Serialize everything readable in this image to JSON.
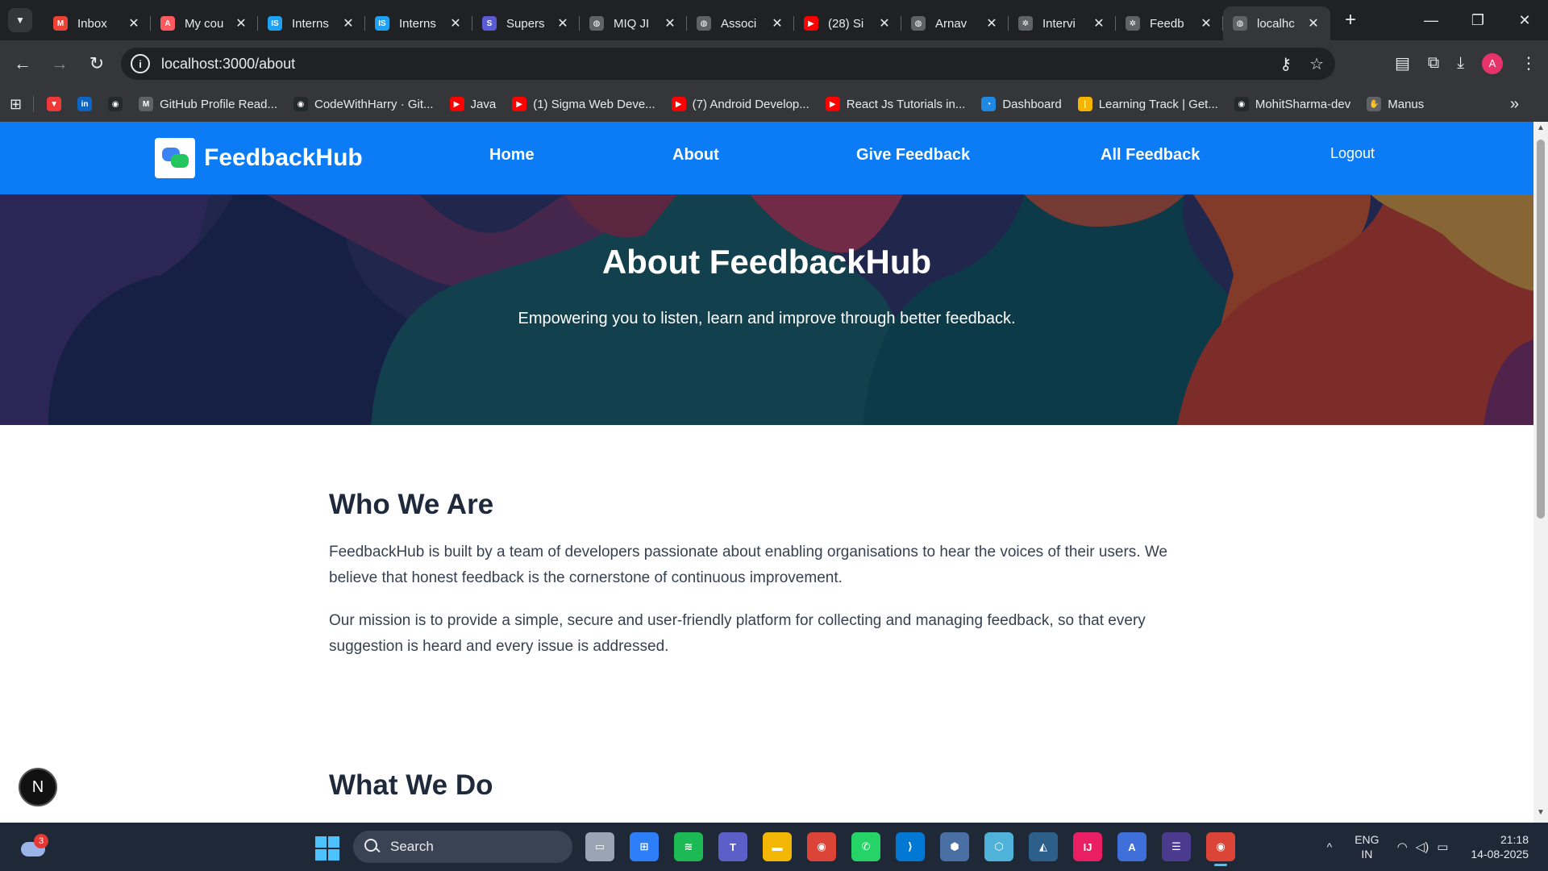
{
  "browser": {
    "tabs": [
      {
        "title": "Inbox",
        "favicon": "gmail-icon",
        "color": "#ea4335",
        "glyph": "M"
      },
      {
        "title": "My cou",
        "favicon": "airbnb-icon",
        "color": "#ff5a5f",
        "glyph": "A"
      },
      {
        "title": "Interns",
        "favicon": "internshala-icon",
        "color": "#1da1f2",
        "glyph": "IS"
      },
      {
        "title": "Interns",
        "favicon": "internshala-icon",
        "color": "#1da1f2",
        "glyph": "IS"
      },
      {
        "title": "Supers",
        "favicon": "superset-icon",
        "color": "#5b5bd6",
        "glyph": "S"
      },
      {
        "title": "MIQ JI",
        "favicon": "globe-icon",
        "color": "#5f6368",
        "glyph": "◍"
      },
      {
        "title": "Associ",
        "favicon": "globe-icon",
        "color": "#5f6368",
        "glyph": "◍"
      },
      {
        "title": "(28) Si",
        "favicon": "youtube-icon",
        "color": "#ff0000",
        "glyph": "▶"
      },
      {
        "title": "Arnav",
        "favicon": "globe-icon",
        "color": "#5f6368",
        "glyph": "◍"
      },
      {
        "title": "Intervi",
        "favicon": "chatgpt-icon",
        "color": "#5f6368",
        "glyph": "✲"
      },
      {
        "title": "Feedb",
        "favicon": "chatgpt-icon",
        "color": "#5f6368",
        "glyph": "✲"
      },
      {
        "title": "localhc",
        "favicon": "globe-icon",
        "color": "#5f6368",
        "glyph": "◍",
        "active": true
      }
    ],
    "url": "localhost:3000/about",
    "profile_initial": "A",
    "bookmarks": [
      {
        "label": "",
        "icon": "vivaldi-icon",
        "color": "#ef3939",
        "glyph": "▼"
      },
      {
        "label": "",
        "icon": "linkedin-icon",
        "color": "#0a66c2",
        "glyph": "in"
      },
      {
        "label": "",
        "icon": "github-icon",
        "color": "#24292e",
        "glyph": "◉"
      },
      {
        "label": "GitHub Profile Read...",
        "icon": "markdown-icon",
        "color": "#5f6368",
        "glyph": "M"
      },
      {
        "label": "CodeWithHarry · Git...",
        "icon": "github-icon",
        "color": "#24292e",
        "glyph": "◉"
      },
      {
        "label": "Java",
        "icon": "youtube-icon",
        "color": "#ff0000",
        "glyph": "▶"
      },
      {
        "label": "(1) Sigma Web Deve...",
        "icon": "youtube-icon",
        "color": "#ff0000",
        "glyph": "▶"
      },
      {
        "label": "(7) Android Develop...",
        "icon": "youtube-icon",
        "color": "#ff0000",
        "glyph": "▶"
      },
      {
        "label": "React Js Tutorials in...",
        "icon": "youtube-icon",
        "color": "#ff0000",
        "glyph": "▶"
      },
      {
        "label": "Dashboard",
        "icon": "dashboard-icon",
        "color": "#1e88e5",
        "glyph": "◔"
      },
      {
        "label": "Learning Track | Get...",
        "icon": "learning-track-icon",
        "color": "#f4b400",
        "glyph": "|"
      },
      {
        "label": "MohitSharma-dev",
        "icon": "github-icon",
        "color": "#24292e",
        "glyph": "◉"
      },
      {
        "label": "Manus",
        "icon": "manus-icon",
        "color": "#5f6368",
        "glyph": "✋"
      }
    ]
  },
  "app": {
    "brand": "FeedbackHub",
    "nav": [
      {
        "label": "Home",
        "key": "home"
      },
      {
        "label": "About",
        "key": "about"
      },
      {
        "label": "Give Feedback",
        "key": "give-feedback"
      },
      {
        "label": "All Feedback",
        "key": "all-feedback"
      }
    ],
    "logout_label": "Logout",
    "accent_color": "#0b7cf5"
  },
  "hero": {
    "title": "About FeedbackHub",
    "subtitle": "Empowering you to listen, learn and improve through better feedback."
  },
  "sections": {
    "who": {
      "heading": "Who We Are",
      "p1": "FeedbackHub is built by a team of developers passionate about enabling organisations to hear the voices of their users. We believe that honest feedback is the cornerstone of continuous improvement.",
      "p2": "Our mission is to provide a simple, secure and user-friendly platform for collecting and managing feedback, so that every suggestion is heard and every issue is addressed."
    },
    "what": {
      "heading": "What We Do"
    }
  },
  "overlay": {
    "badge_letter": "N"
  },
  "taskbar": {
    "weather_badge": "3",
    "search_label": "Search",
    "apps": [
      {
        "icon": "task-view-icon",
        "color": "#9aa4b5",
        "glyph": "▭"
      },
      {
        "icon": "microsoft-store-icon",
        "color": "#2d7ff9",
        "glyph": "⊞"
      },
      {
        "icon": "spotify-icon",
        "color": "#1db954",
        "glyph": "≋"
      },
      {
        "icon": "teams-icon",
        "color": "#5b5fc7",
        "glyph": "T"
      },
      {
        "icon": "file-explorer-icon",
        "color": "#f2b705",
        "glyph": "▬"
      },
      {
        "icon": "chrome-icon",
        "color": "#db4437",
        "glyph": "◉"
      },
      {
        "icon": "whatsapp-icon",
        "color": "#25d366",
        "glyph": "✆"
      },
      {
        "icon": "vscode-icon",
        "color": "#0078d4",
        "glyph": "⟩"
      },
      {
        "icon": "virtualbox-icon",
        "color": "#4a6fa5",
        "glyph": "⬢"
      },
      {
        "icon": "cube-app-icon",
        "color": "#4fb3d9",
        "glyph": "⬡"
      },
      {
        "icon": "mysql-workbench-icon",
        "color": "#2d5f8b",
        "glyph": "◭"
      },
      {
        "icon": "intellij-icon",
        "color": "#e91e63",
        "glyph": "IJ"
      },
      {
        "icon": "app-launcher-icon",
        "color": "#3f6fd8",
        "glyph": "A"
      },
      {
        "icon": "eclipse-icon",
        "color": "#4a3b8f",
        "glyph": "☰"
      },
      {
        "icon": "chrome-profile-icon",
        "color": "#db4437",
        "glyph": "◉",
        "active": true
      }
    ],
    "language": "ENG",
    "region": "IN",
    "time": "21:18",
    "date": "14-08-2025"
  }
}
